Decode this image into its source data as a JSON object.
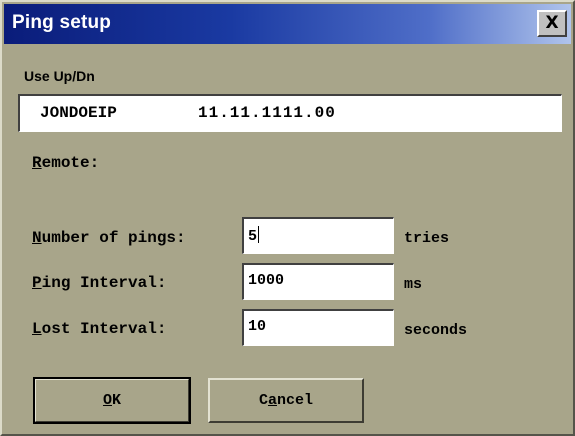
{
  "window": {
    "title": "Ping setup",
    "close_label": "X"
  },
  "updn": {
    "label": "Use Up/Dn",
    "name": "JONDOEIP",
    "ip": "11.11.1111.00"
  },
  "remote": {
    "label_first": "R",
    "label_rest": "emote:"
  },
  "pings": {
    "label_first": "N",
    "label_rest": "umber of pings:",
    "value": "5",
    "unit": "tries"
  },
  "interval": {
    "label_first": "P",
    "label_rest": "ing Interval:",
    "value": "1000",
    "unit": "ms"
  },
  "lost": {
    "label_first": "L",
    "label_rest": "ost Interval:",
    "value": "10",
    "unit": "seconds"
  },
  "buttons": {
    "ok_first": "O",
    "ok_rest": "K",
    "cancel_pre": "C",
    "cancel_under": "a",
    "cancel_post": "ncel"
  },
  "colors": {
    "dialog_bg": "#a8a58a",
    "title_start": "#0a1c7a",
    "title_end": "#b0c4ec"
  }
}
